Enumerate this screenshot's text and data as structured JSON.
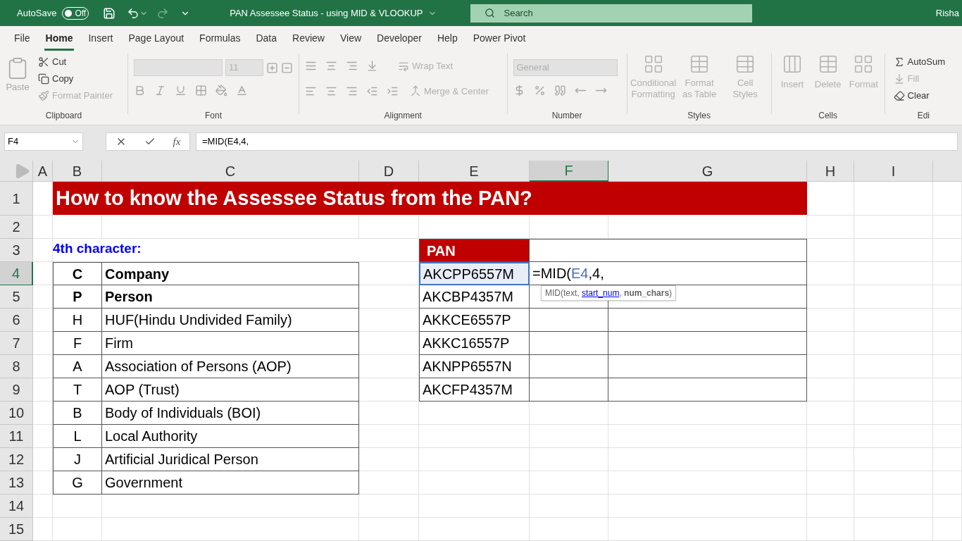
{
  "title_bar": {
    "autosave_label": "AutoSave",
    "autosave_toggle": {
      "on": false,
      "label": "Off"
    },
    "title": "PAN Assessee Status - using MID & VLOOKUP",
    "search_placeholder": "Search",
    "user": "Risha"
  },
  "tabs": [
    {
      "label": "File",
      "selected": false
    },
    {
      "label": "Home",
      "selected": true
    },
    {
      "label": "Insert",
      "selected": false
    },
    {
      "label": "Page Layout",
      "selected": false
    },
    {
      "label": "Formulas",
      "selected": false
    },
    {
      "label": "Data",
      "selected": false
    },
    {
      "label": "Review",
      "selected": false
    },
    {
      "label": "View",
      "selected": false
    },
    {
      "label": "Developer",
      "selected": false
    },
    {
      "label": "Help",
      "selected": false
    },
    {
      "label": "Power Pivot",
      "selected": false
    }
  ],
  "ribbon": {
    "clipboard": {
      "label": "Clipboard",
      "paste": {
        "label": "Paste",
        "disabled": true
      },
      "cut": {
        "label": "Cut",
        "disabled": false
      },
      "copy": {
        "label": "Copy",
        "disabled": false
      },
      "format_painter": {
        "label": "Format Painter",
        "disabled": true
      }
    },
    "font": {
      "label": "Font",
      "size": "11"
    },
    "alignment": {
      "label": "Alignment",
      "wrap_text": "Wrap Text",
      "merge": "Merge & Center"
    },
    "number": {
      "label": "Number",
      "format": "General"
    },
    "styles": {
      "label": "Styles",
      "items": [
        {
          "label": "Conditional Formatting",
          "disabled": true
        },
        {
          "label": "Format as Table",
          "disabled": true
        },
        {
          "label": "Cell Styles",
          "disabled": true
        }
      ]
    },
    "cells": {
      "label": "Cells",
      "items": [
        {
          "label": "Insert",
          "disabled": true
        },
        {
          "label": "Delete",
          "disabled": true
        },
        {
          "label": "Format",
          "disabled": true
        }
      ]
    },
    "editing": {
      "label": "Edi",
      "autosum": {
        "label": "AutoSum",
        "disabled": false
      },
      "fill": {
        "label": "Fill",
        "disabled": true
      },
      "clear": {
        "label": "Clear",
        "disabled": false
      }
    }
  },
  "formula_bar": {
    "name_box": "F4",
    "function_button": "fx",
    "formula": "=MID(E4,4,"
  },
  "sheet": {
    "columns": [
      {
        "label": "A",
        "selected": false
      },
      {
        "label": "B",
        "selected": false
      },
      {
        "label": "C",
        "selected": false
      },
      {
        "label": "D",
        "selected": false
      },
      {
        "label": "E",
        "selected": false
      },
      {
        "label": "F",
        "selected": true
      },
      {
        "label": "G",
        "selected": false
      },
      {
        "label": "H",
        "selected": false
      },
      {
        "label": "I",
        "selected": false
      }
    ],
    "rows": [
      {
        "label": "1",
        "selected": false
      },
      {
        "label": "2",
        "selected": false
      },
      {
        "label": "3",
        "selected": false
      },
      {
        "label": "4",
        "selected": true
      },
      {
        "label": "5",
        "selected": false
      },
      {
        "label": "6",
        "selected": false
      },
      {
        "label": "7",
        "selected": false
      },
      {
        "label": "8",
        "selected": false
      },
      {
        "label": "9",
        "selected": false
      },
      {
        "label": "10",
        "selected": false
      },
      {
        "label": "11",
        "selected": false
      },
      {
        "label": "12",
        "selected": false
      },
      {
        "label": "13",
        "selected": false
      },
      {
        "label": "14",
        "selected": false
      },
      {
        "label": "15",
        "selected": false
      }
    ],
    "title": "How to know the Assessee Status from the PAN?",
    "code_label": "4th character:",
    "code_table": [
      {
        "code": "C",
        "meaning": "Company",
        "bold": true
      },
      {
        "code": "P",
        "meaning": "Person",
        "bold": true
      },
      {
        "code": "H",
        "meaning": "HUF(Hindu Undivided Family)",
        "bold": false
      },
      {
        "code": "F",
        "meaning": "Firm",
        "bold": false
      },
      {
        "code": "A",
        "meaning": "Association of Persons (AOP)",
        "bold": false
      },
      {
        "code": "T",
        "meaning": "AOP (Trust)",
        "bold": false
      },
      {
        "code": "B",
        "meaning": "Body of Individuals (BOI)",
        "bold": false
      },
      {
        "code": "L",
        "meaning": "Local Authority",
        "bold": false
      },
      {
        "code": "J",
        "meaning": "Artificial Juridical Person",
        "bold": false
      },
      {
        "code": "G",
        "meaning": "Government",
        "bold": false
      }
    ],
    "pan_header": "PAN",
    "pans": [
      "AKCPP6557M",
      "AKCBP4357M",
      "AKKCE6557P",
      "AKKC16557P",
      "AKNPP6557N",
      "AKCFP4357M"
    ],
    "editing_cell": {
      "prefix": "=MID(",
      "reference": "E4",
      "suffix": ",4,"
    },
    "tooltip": {
      "before": "MID(text, ",
      "current": "start_num",
      "after": ", **num_chars**)"
    }
  }
}
